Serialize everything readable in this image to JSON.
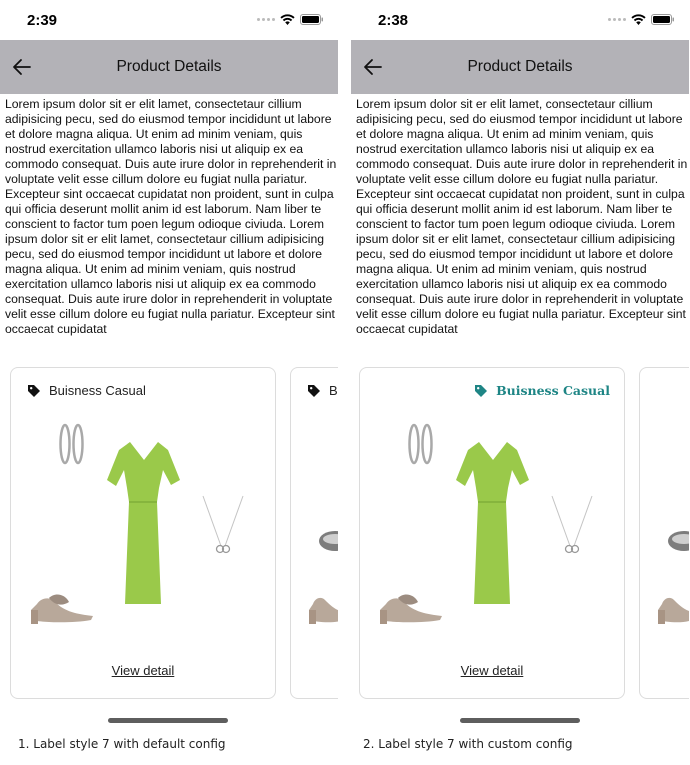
{
  "screens": [
    {
      "time": "2:39",
      "title": "Product Details",
      "card_label": "Buisness Casual",
      "next_card_label": "B",
      "view_detail": "View detail",
      "caption": "1. Label style 7 with default config"
    },
    {
      "time": "2:38",
      "title": "Product Details",
      "card_label": "Buisness Casual",
      "next_card_label": "",
      "view_detail": "View detail",
      "caption": "2. Label style 7 with custom config",
      "label_color": "#1e8585"
    }
  ],
  "description": "Lorem ipsum dolor sit er elit lamet, consectetaur cillium adipisicing pecu, sed do eiusmod tempor incididunt ut labore et dolore magna aliqua. Ut enim ad minim veniam, quis nostrud exercitation ullamco laboris nisi ut aliquip ex ea commodo consequat. Duis aute irure dolor in reprehenderit in voluptate velit esse cillum dolore eu fugiat nulla pariatur. Excepteur sint occaecat cupidatat non proident, sunt in culpa qui officia deserunt mollit anim id est laborum. Nam liber te conscient to factor tum poen legum odioque civiuda. Lorem ipsum dolor sit er elit lamet, consectetaur cillium adipisicing pecu, sed do eiusmod tempor incididunt ut labore et dolore magna aliqua. Ut enim ad minim veniam, quis nostrud exercitation ullamco laboris nisi ut aliquip ex ea commodo consequat. Duis aute irure dolor in reprehenderit in voluptate velit esse cillum dolore eu fugiat nulla pariatur. Excepteur sint occaecat cupidatat",
  "icons": {
    "back": "arrow-left-icon",
    "tag": "tag-icon",
    "wifi": "wifi-icon",
    "battery": "battery-icon"
  },
  "colors": {
    "nav_bar": "#b3b2b7",
    "dress": "#9ac94a",
    "custom_label": "#1e8585"
  }
}
